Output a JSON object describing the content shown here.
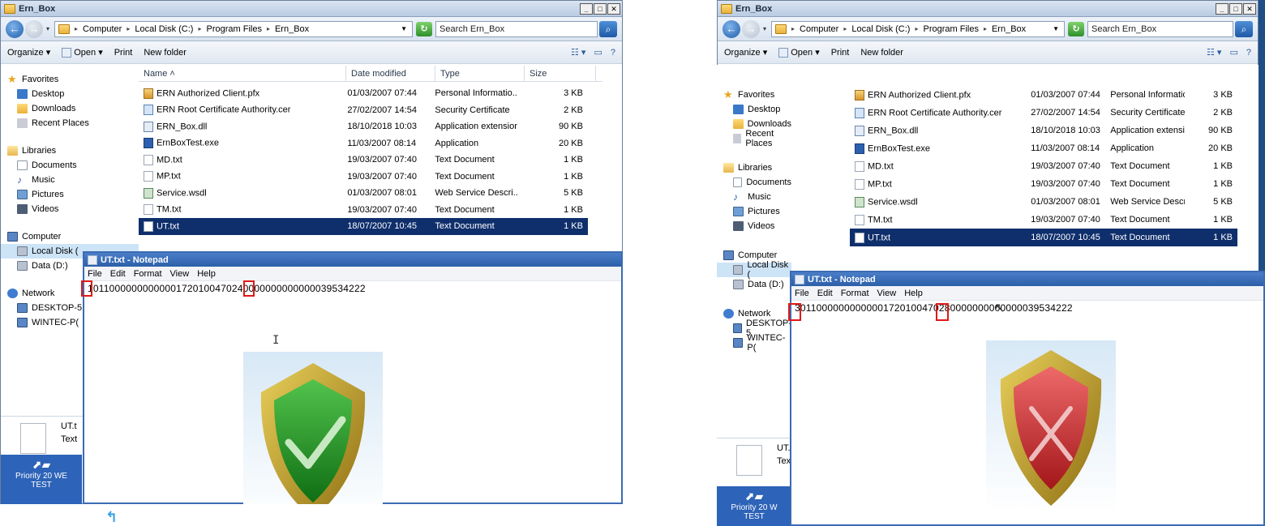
{
  "explorer": {
    "window_title": "Ern_Box",
    "breadcrumbs": [
      "Computer",
      "Local Disk (C:)",
      "Program Files",
      "Ern_Box"
    ],
    "search_placeholder": "Search Ern_Box",
    "toolbar": {
      "organize": "Organize",
      "open": "Open",
      "print": "Print",
      "new_folder": "New folder"
    },
    "columns": {
      "name": "Name",
      "date": "Date modified",
      "type": "Type",
      "size": "Size"
    },
    "nav": {
      "favorites": "Favorites",
      "desktop": "Desktop",
      "downloads": "Downloads",
      "recent": "Recent Places",
      "libraries": "Libraries",
      "documents": "Documents",
      "music": "Music",
      "pictures": "Pictures",
      "videos": "Videos",
      "computer": "Computer",
      "local_disk": "Local Disk (",
      "data": "Data (D:)",
      "network": "Network",
      "desktop_pc": "DESKTOP-5",
      "wintec": "WINTEC-P("
    },
    "files_left": [
      {
        "name": "ERN Authorized Client.pfx",
        "date": "01/03/2007 07:44",
        "type": "Personal Informatio...",
        "size": "3 KB",
        "icon": "cert"
      },
      {
        "name": "ERN Root Certificate Authority.cer",
        "date": "27/02/2007 14:54",
        "type": "Security Certificate",
        "size": "2 KB",
        "icon": "cer"
      },
      {
        "name": "ERN_Box.dll",
        "date": "18/10/2018 10:03",
        "type": "Application extension",
        "size": "90 KB",
        "icon": "dll"
      },
      {
        "name": "ErnBoxTest.exe",
        "date": "11/03/2007 08:14",
        "type": "Application",
        "size": "20 KB",
        "icon": "exe"
      },
      {
        "name": "MD.txt",
        "date": "19/03/2007 07:40",
        "type": "Text Document",
        "size": "1 KB",
        "icon": "txt"
      },
      {
        "name": "MP.txt",
        "date": "19/03/2007 07:40",
        "type": "Text Document",
        "size": "1 KB",
        "icon": "txt"
      },
      {
        "name": "Service.wsdl",
        "date": "01/03/2007 08:01",
        "type": "Web Service Descri...",
        "size": "5 KB",
        "icon": "wsdl"
      },
      {
        "name": "TM.txt",
        "date": "19/03/2007 07:40",
        "type": "Text Document",
        "size": "1 KB",
        "icon": "txt"
      },
      {
        "name": "UT.txt",
        "date": "18/07/2007 10:45",
        "type": "Text Document",
        "size": "1 KB",
        "icon": "txt",
        "selected": true
      }
    ],
    "files_right": [
      {
        "name": "ERN Authorized Client.pfx",
        "date": "01/03/2007 07:44",
        "type": "Personal Informatio...",
        "size": "3 KB",
        "icon": "cert"
      },
      {
        "name": "ERN Root Certificate Authority.cer",
        "date": "27/02/2007 14:54",
        "type": "Security Certificate",
        "size": "2 KB",
        "icon": "cer"
      },
      {
        "name": "ERN_Box.dll",
        "date": "18/10/2018 10:03",
        "type": "Application extension",
        "size": "90 KB",
        "icon": "dll"
      },
      {
        "name": "ErnBoxTest.exe",
        "date": "11/03/2007 08:14",
        "type": "Application",
        "size": "20 KB",
        "icon": "exe"
      },
      {
        "name": "MD.txt",
        "date": "19/03/2007 07:40",
        "type": "Text Document",
        "size": "1 KB",
        "icon": "txt"
      },
      {
        "name": "MP.txt",
        "date": "19/03/2007 07:40",
        "type": "Text Document",
        "size": "1 KB",
        "icon": "txt"
      },
      {
        "name": "Service.wsdl",
        "date": "01/03/2007 08:01",
        "type": "Web Service Descri...",
        "size": "5 KB",
        "icon": "wsdl"
      },
      {
        "name": "TM.txt",
        "date": "19/03/2007 07:40",
        "type": "Text Document",
        "size": "1 KB",
        "icon": "txt"
      },
      {
        "name": "UT.txt",
        "date": "18/07/2007 10:45",
        "type": "Text Document",
        "size": "1 KB",
        "icon": "txt",
        "selected": true
      }
    ],
    "details_name": "UT.t",
    "details_type": "Text"
  },
  "taskbar": {
    "label_line1": "Priority 20 WE",
    "label_line2": "TEST"
  },
  "taskbar_right": {
    "label_line1": "Priority 20 W",
    "label_line2": "TEST"
  },
  "notepad": {
    "title": "UT.txt - Notepad",
    "menu": [
      "File",
      "Edit",
      "Format",
      "View",
      "Help"
    ],
    "content_left": "10110000000000001720100470240000000000000039534222",
    "content_right": "30110000000000001720100470280000000000000039534222"
  },
  "colors": {
    "valid_shield": "#1e9a22",
    "invalid_shield": "#c8262a",
    "shield_rim": "#c9a227",
    "highlight": "#e01818",
    "selection": "#0f2f6c"
  }
}
